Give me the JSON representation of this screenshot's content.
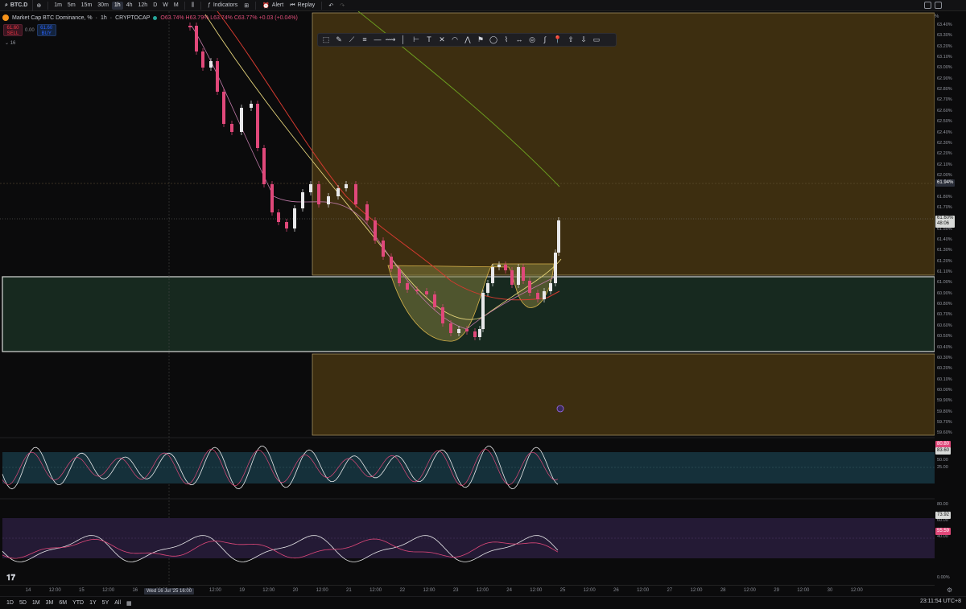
{
  "toolbar": {
    "symbol": "BTC.D",
    "intervals": [
      "1m",
      "5m",
      "15m",
      "30m",
      "1h",
      "4h",
      "12h",
      "D",
      "W",
      "M"
    ],
    "active_interval": "1h",
    "indicators_label": "Indicators",
    "alert_label": "Alert",
    "replay_label": "Replay"
  },
  "header": {
    "title": "Market Cap BTC Dominance, %",
    "interval": "1h",
    "exchange": "CRYPTOCAP",
    "ohlc": "O63.74% H63.79% L63.74% C63.77% +0.03 (+0.04%)",
    "sell_price": "61.60",
    "sell_label": "SELL",
    "spread": "0.00",
    "buy_price": "61.60",
    "buy_label": "BUY",
    "indicator_count": "16"
  },
  "drawing_tools": [
    "rect-select-icon",
    "brush-icon",
    "trendline-icon",
    "parallel-channel-icon",
    "horizontal-line-icon",
    "path-icon",
    "vertical-line-icon",
    "range-icon",
    "text-icon",
    "crossline-icon",
    "arc-icon",
    "pattern-icon",
    "flag-icon",
    "ellipse-icon",
    "polyline-icon",
    "measure-icon",
    "circle-icon",
    "curve-icon",
    "pin-icon",
    "arrow-up-icon",
    "arrow-down-icon",
    "callout-icon"
  ],
  "price_axis": {
    "unit": "%",
    "labels": [
      "63.40%",
      "63.30%",
      "63.20%",
      "63.10%",
      "63.00%",
      "62.90%",
      "62.80%",
      "62.70%",
      "62.60%",
      "62.50%",
      "62.40%",
      "62.30%",
      "62.20%",
      "62.10%",
      "62.00%",
      "61.90%",
      "61.80%",
      "61.70%",
      "61.60%",
      "61.50%",
      "61.40%",
      "61.30%",
      "61.20%",
      "61.10%",
      "61.00%",
      "60.90%",
      "60.80%",
      "60.70%",
      "60.60%",
      "60.50%",
      "60.40%",
      "60.30%",
      "60.20%",
      "60.10%",
      "60.00%",
      "59.90%",
      "59.80%",
      "59.70%",
      "59.60%"
    ],
    "crosshair_price": "61.94%",
    "last_price": "61.60%",
    "countdown": "48:06"
  },
  "stoch_pane": {
    "labels": [
      "75.00",
      "50.00",
      "25.00"
    ],
    "tag1": "80.80",
    "tag2": "83.60"
  },
  "rsi_pane": {
    "labels": [
      "80.00",
      "60.00",
      "40.00"
    ],
    "tag1": "73.92",
    "tag2": "55.59",
    "bottom_label": "0.00%"
  },
  "time_axis": {
    "labels": [
      "14",
      "12:00",
      "15",
      "12:00",
      "16",
      "12:00",
      "18",
      "12:00",
      "19",
      "12:00",
      "20",
      "12:00",
      "21",
      "12:00",
      "22",
      "12:00",
      "23",
      "12:00",
      "24",
      "12:00",
      "25",
      "12:00",
      "26",
      "12:00",
      "27",
      "12:00",
      "28",
      "12:00",
      "29",
      "12:00",
      "30",
      "12:00"
    ],
    "cursor_date": "Wed 16 Jul '25  16:00"
  },
  "bottom_bar": {
    "ranges": [
      "1D",
      "5D",
      "1M",
      "3M",
      "6M",
      "YTD",
      "1Y",
      "5Y",
      "All"
    ],
    "clock": "23:11:54 UTC+8"
  },
  "colors": {
    "bull": "#e8e8ea",
    "bear": "#e0487a",
    "supply_zone": "#3d2e10",
    "demand_zone": "#17291f",
    "stoch_band": "#15303a",
    "rsi_band": "#241a35"
  },
  "chart_data": {
    "type": "candlestick",
    "symbol": "BTC.D",
    "interval": "1h",
    "yrange": [
      59.6,
      63.45
    ],
    "annotations": [
      "cup and handle pattern",
      "supply zone above 61.08%",
      "demand zone 60.35%–61.08%"
    ]
  }
}
